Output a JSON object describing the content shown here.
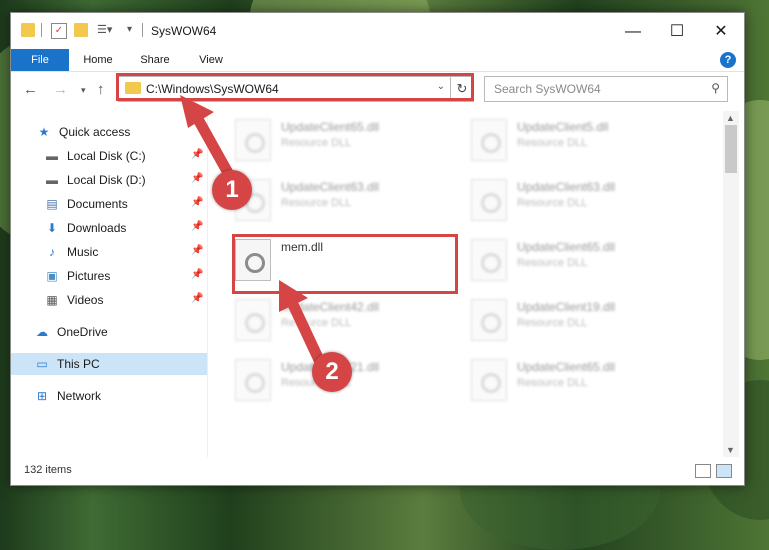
{
  "window": {
    "title": "SysWOW64"
  },
  "window_controls": {
    "minimize": "—",
    "maximize": "☐",
    "close": "✕"
  },
  "ribbon": {
    "tabs": [
      "File",
      "Home",
      "Share",
      "View"
    ]
  },
  "address": {
    "path": "C:\\Windows\\SysWOW64"
  },
  "search": {
    "placeholder": "Search SysWOW64"
  },
  "sidebar": {
    "items": [
      {
        "label": "Quick access",
        "icon": "star-icon",
        "pinned": false
      },
      {
        "label": "Local Disk (C:)",
        "icon": "drive-icon",
        "pinned": true
      },
      {
        "label": "Local Disk (D:)",
        "icon": "drive-icon",
        "pinned": true
      },
      {
        "label": "Documents",
        "icon": "documents-icon",
        "pinned": true
      },
      {
        "label": "Downloads",
        "icon": "download-icon",
        "pinned": true
      },
      {
        "label": "Music",
        "icon": "music-icon",
        "pinned": true
      },
      {
        "label": "Pictures",
        "icon": "pictures-icon",
        "pinned": true
      },
      {
        "label": "Videos",
        "icon": "videos-icon",
        "pinned": true
      },
      {
        "label": "OneDrive",
        "icon": "cloud-icon",
        "pinned": false
      },
      {
        "label": "This PC",
        "icon": "computer-icon",
        "pinned": false,
        "selected": true
      },
      {
        "label": "Network",
        "icon": "network-icon",
        "pinned": false
      }
    ]
  },
  "files": [
    {
      "name": "UpdateClient65.dll",
      "type": "Resource DLL"
    },
    {
      "name": "UpdateClient5.dll",
      "type": "Resource DLL"
    },
    {
      "name": "UpdateClient63.dll",
      "type": "Resource DLL"
    },
    {
      "name": "UpdateClient63.dll",
      "type": "Resource DLL"
    },
    {
      "name": "mem.dll",
      "type": ""
    },
    {
      "name": "UpdateClient65.dll",
      "type": "Resource DLL"
    },
    {
      "name": "UpdateClient42.dll",
      "type": "Resource DLL"
    },
    {
      "name": "UpdateClient19.dll",
      "type": "Resource DLL"
    },
    {
      "name": "UpdateClient21.dll",
      "type": "Resource DLL"
    },
    {
      "name": "UpdateClient65.dll",
      "type": "Resource DLL"
    }
  ],
  "status": {
    "item_count": "132 items"
  },
  "annotations": {
    "step1": "1",
    "step2": "2"
  },
  "colors": {
    "highlight": "#d64545",
    "accent": "#1a73c8",
    "folder": "#f2c94c"
  }
}
